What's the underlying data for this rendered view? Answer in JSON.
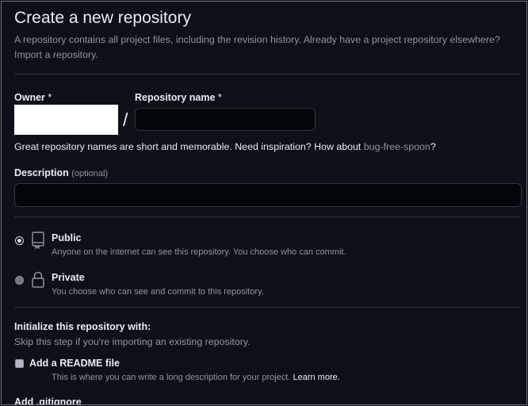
{
  "header": {
    "title": "Create a new repository",
    "subtitle": "A repository contains all project files, including the revision history. Already have a project repository elsewhere?",
    "import_link": "Import a repository."
  },
  "owner": {
    "label": "Owner",
    "required_mark": "*"
  },
  "separator": "/",
  "repo_name": {
    "label": "Repository name",
    "required_mark": "*",
    "value": ""
  },
  "name_hint": {
    "text": "Great repository names are short and memorable. Need inspiration? How about ",
    "suggestion": "bug-free-spoon",
    "suffix": "?"
  },
  "description": {
    "label": "Description",
    "optional": "(optional)",
    "value": ""
  },
  "visibility": {
    "public": {
      "title": "Public",
      "desc": "Anyone on the internet can see this repository. You choose who can commit.",
      "icon": "repo-icon",
      "selected": true
    },
    "private": {
      "title": "Private",
      "desc": "You choose who can see and commit to this repository.",
      "icon": "lock-icon",
      "selected": false
    }
  },
  "initialize": {
    "title": "Initialize this repository with:",
    "subtitle": "Skip this step if you're importing an existing repository.",
    "readme": {
      "label": "Add a README file",
      "desc": "This is where you can write a long description for your project.",
      "learn_more": "Learn more.",
      "checked": false
    },
    "gitignore_label": "Add .gitignore"
  },
  "colors": {
    "background": "#0d1117",
    "border": "#30363d",
    "text": "#e6edf3",
    "muted": "#8d96a0"
  }
}
